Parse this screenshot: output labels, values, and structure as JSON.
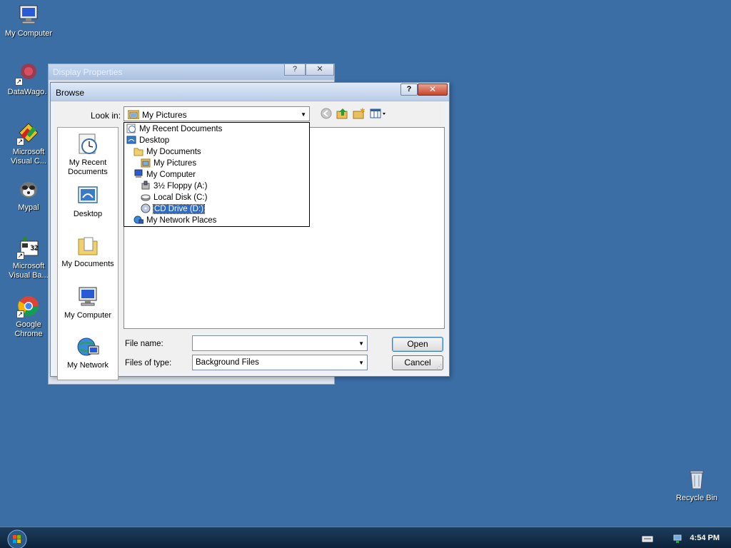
{
  "desktop": {
    "icons": [
      {
        "label": "My Computer",
        "icon": "computer-icon"
      },
      {
        "label": "DataWago.",
        "icon": "datawago-icon"
      },
      {
        "label": "Microsoft\nVisual C...",
        "icon": "visual-c-icon"
      },
      {
        "label": "Mypal",
        "icon": "mypal-icon"
      },
      {
        "label": "Microsoft\nVisual Ba...",
        "icon": "visual-basic-icon"
      },
      {
        "label": "Google\nChrome",
        "icon": "chrome-icon"
      },
      {
        "label": "Recycle Bin",
        "icon": "recycle-bin-icon"
      }
    ]
  },
  "background_window": {
    "title": "Display Properties",
    "help_label": "?",
    "close_label": "✕"
  },
  "dialog": {
    "title": "Browse",
    "help_label": "?",
    "close_label": "✕",
    "look_in_label": "Look in:",
    "look_in_value": "My Pictures",
    "dropdown_items": [
      {
        "label": "My Recent Documents",
        "icon": "recent-documents-icon",
        "level": 0
      },
      {
        "label": "Desktop",
        "icon": "desktop-icon",
        "level": 0
      },
      {
        "label": "My Documents",
        "icon": "folder-icon",
        "level": 1
      },
      {
        "label": "My Pictures",
        "icon": "pictures-folder-icon",
        "level": 2
      },
      {
        "label": "My Computer",
        "icon": "computer-icon",
        "level": 1
      },
      {
        "label": "3½ Floppy (A:)",
        "icon": "floppy-icon",
        "level": 2
      },
      {
        "label": "Local Disk (C:)",
        "icon": "disk-icon",
        "level": 2
      },
      {
        "label": "CD Drive (D:)",
        "icon": "cd-drive-icon",
        "level": 2,
        "selected": true
      },
      {
        "label": "My Network Places",
        "icon": "network-icon",
        "level": 1
      }
    ],
    "places": [
      {
        "label": "My Recent\nDocuments",
        "icon": "recent-documents-icon"
      },
      {
        "label": "Desktop",
        "icon": "desktop-icon"
      },
      {
        "label": "My Documents",
        "icon": "folder-icon"
      },
      {
        "label": "My Computer",
        "icon": "computer-icon"
      },
      {
        "label": "My Network",
        "icon": "network-icon"
      }
    ],
    "file_name_label": "File name:",
    "file_name_value": "",
    "files_of_type_label": "Files of type:",
    "files_of_type_value": "Background Files",
    "open_label": "Open",
    "cancel_label": "Cancel"
  },
  "taskbar": {
    "clock": "4:54 PM"
  },
  "colors": {
    "desktop": "#3a6ea5",
    "selection": "#316ac5",
    "close_button": "#c6452b"
  }
}
